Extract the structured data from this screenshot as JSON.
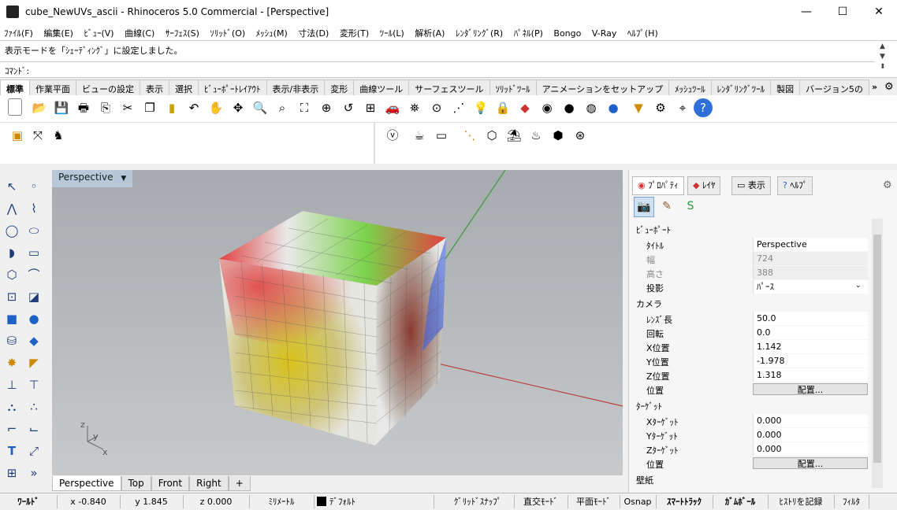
{
  "window": {
    "title": "cube_NewUVs_ascii - Rhinoceros 5.0 Commercial - [Perspective]",
    "min": "—",
    "max": "☐",
    "close": "✕"
  },
  "menu": [
    "ﾌｧｲﾙ(F)",
    "編集(E)",
    "ﾋﾞｭｰ(V)",
    "曲線(C)",
    "ｻｰﾌｪｽ(S)",
    "ｿﾘｯﾄﾞ(O)",
    "ﾒｯｼｭ(M)",
    "寸法(D)",
    "変形(T)",
    "ﾂｰﾙ(L)",
    "解析(A)",
    "ﾚﾝﾀﾞﾘﾝｸﾞ(R)",
    "ﾊﾟﾈﾙ(P)",
    "Bongo",
    "V-Ray",
    "ﾍﾙﾌﾟ(H)"
  ],
  "command": {
    "history": "表示モードを「ｼｪｰﾃﾞｨﾝｸﾞ」に設定しました。",
    "prompt": "ｺﾏﾝﾄﾞ:",
    "value": ""
  },
  "toolbar_tabs": [
    "標準",
    "作業平面",
    "ビューの設定",
    "表示",
    "選択",
    "ﾋﾞｭｰﾎﾟｰﾄﾚｲｱｳﾄ",
    "表示/非表示",
    "変形",
    "曲線ツール",
    "サーフェスツール",
    "ｿﾘｯﾄﾞﾂｰﾙ",
    "アニメーションをセットアップ",
    "ﾒｯｼｭﾂｰﾙ",
    "ﾚﾝﾀﾞﾘﾝｸﾞﾂｰﾙ",
    "製図",
    "バージョン5の"
  ],
  "viewport": {
    "title": "Perspective",
    "tabs": [
      "Perspective",
      "Top",
      "Front",
      "Right"
    ],
    "add_tab": "+"
  },
  "panel": {
    "tabs": [
      "ﾌﾟﾛﾊﾟﾃｨ",
      "ﾚｲﾔ",
      "表示",
      "ﾍﾙﾌﾟ"
    ],
    "sections": {
      "viewport": "ﾋﾞｭｰﾎﾟｰﾄ",
      "camera": "カメラ",
      "target": "ﾀｰｹﾞｯﾄ",
      "wallpaper": "壁紙"
    },
    "viewport_rows": [
      {
        "label": "ﾀｲﾄﾙ",
        "value": "Perspective"
      },
      {
        "label": "幅",
        "value": "724"
      },
      {
        "label": "高さ",
        "value": "388"
      },
      {
        "label": "投影",
        "value": "ﾊﾟｰｽ"
      }
    ],
    "camera_rows": [
      {
        "label": "ﾚﾝｽﾞ長",
        "value": "50.0"
      },
      {
        "label": "回転",
        "value": "0.0"
      },
      {
        "label": "X位置",
        "value": "1.142"
      },
      {
        "label": "Y位置",
        "value": "-1.978"
      },
      {
        "label": "Z位置",
        "value": "1.318"
      },
      {
        "label": "位置",
        "value": "配置..."
      }
    ],
    "target_rows": [
      {
        "label": "Xﾀｰｹﾞｯﾄ",
        "value": "0.000"
      },
      {
        "label": "Yﾀｰｹﾞｯﾄ",
        "value": "0.000"
      },
      {
        "label": "Zﾀｰｹﾞｯﾄ",
        "value": "0.000"
      },
      {
        "label": "位置",
        "value": "配置..."
      }
    ]
  },
  "status": {
    "world": "ﾜｰﾙﾄﾞ",
    "x": "x -0.840",
    "y": "y 1.845",
    "z": "z 0.000",
    "units": "ﾐﾘﾒｰﾄﾙ",
    "layer": "ﾃﾞﾌｫﾙﾄ",
    "gridsnap": "ｸﾞﾘｯﾄﾞｽﾅｯﾌﾟ",
    "ortho": "直交ﾓｰﾄﾞ",
    "planar": "平面ﾓｰﾄﾞ",
    "osnap": "Osnap",
    "smarttrack": "ｽﾏｰﾄﾄﾗｯｸ",
    "gumball": "ｶﾞﾑﾎﾞｰﾙ",
    "history": "ﾋｽﾄﾘを記録",
    "filter": "ﾌｨﾙﾀ"
  },
  "colors": {
    "accent": "#1e62c8",
    "viewport_bg": "#b5b8bb",
    "layer_swatch": "#000000"
  }
}
